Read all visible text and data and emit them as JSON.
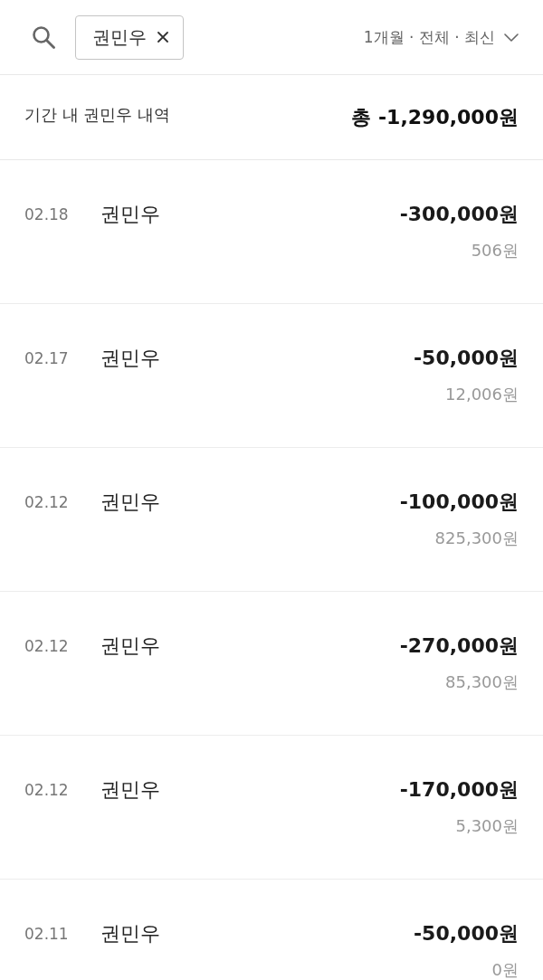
{
  "search": {
    "chip_label": "권민우"
  },
  "filter": {
    "label": "1개월 · 전체 · 최신"
  },
  "summary": {
    "label": "기간 내 권민우 내역",
    "total": "총 -1,290,000원"
  },
  "transactions": [
    {
      "date": "02.18",
      "name": "권민우",
      "amount": "-300,000원",
      "balance": "506원"
    },
    {
      "date": "02.17",
      "name": "권민우",
      "amount": "-50,000원",
      "balance": "12,006원"
    },
    {
      "date": "02.12",
      "name": "권민우",
      "amount": "-100,000원",
      "balance": "825,300원"
    },
    {
      "date": "02.12",
      "name": "권민우",
      "amount": "-270,000원",
      "balance": "85,300원"
    },
    {
      "date": "02.12",
      "name": "권민우",
      "amount": "-170,000원",
      "balance": "5,300원"
    },
    {
      "date": "02.11",
      "name": "권민우",
      "amount": "-50,000원",
      "balance": "0원"
    }
  ]
}
